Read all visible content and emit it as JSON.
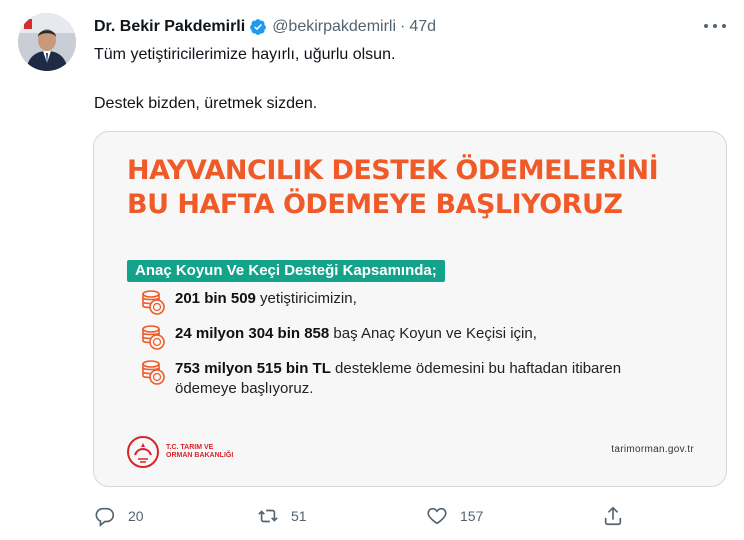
{
  "tweet": {
    "author_name": "Dr. Bekir Pakdemirli",
    "handle": "@bekirpakdemirli",
    "separator": "·",
    "time": "47d",
    "line1": "Tüm yetiştiricilerimize hayırlı, uğurlu olsun.",
    "line2": "Destek bizden, üretmek sizden."
  },
  "card": {
    "headline_line1": "HAYVANCILIK DESTEK ÖDEMELERİNİ",
    "headline_line2": "BU HAFTA ÖDEMEYE BAŞLIYORUZ",
    "badge": "Anaç Koyun Ve Keçi Desteği Kapsamında;",
    "items": [
      {
        "bold": "201 bin 509",
        "rest": " yetiştiricimizin,"
      },
      {
        "bold": "24 milyon 304 bin 858",
        "rest": " baş Anaç Koyun ve Keçisi için,"
      },
      {
        "bold": "753 milyon 515 bin TL",
        "rest": " destekleme ödemesini bu haftadan itibaren ödemeye başlıyoruz."
      }
    ],
    "logo_text_line1": "T.C. TARIM VE",
    "logo_text_line2": "ORMAN BAKANLIĞI",
    "website": "tarimorman.gov.tr"
  },
  "actions": {
    "replies": "20",
    "retweets": "51",
    "likes": "157"
  },
  "colors": {
    "headline": "#ef5a28",
    "badge": "#12a38a",
    "verified": "#1d9bf0"
  }
}
